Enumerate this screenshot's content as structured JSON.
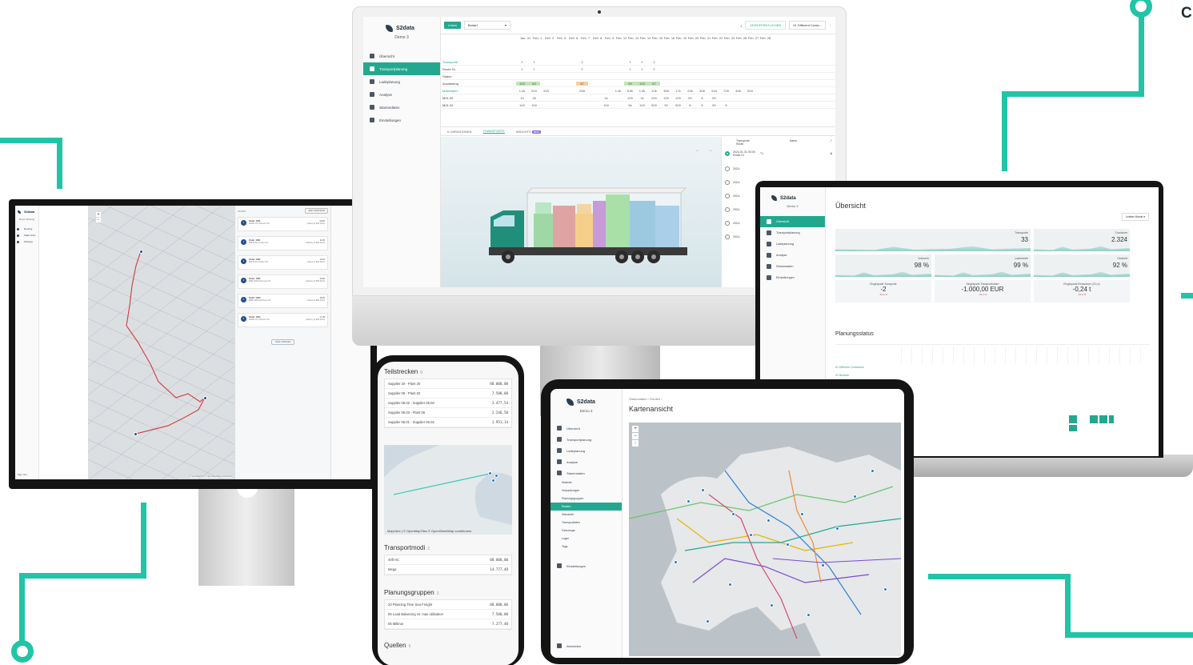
{
  "brand": {
    "logo": "S2data",
    "demo": "Demo 3",
    "accent": "#23a88f",
    "line_color": "#21c4a7"
  },
  "imac": {
    "toolbar": {
      "mode": "Lösen",
      "select": "Bedarf",
      "share": "VERÖFFENTLICHEN",
      "dropdown": "01 Different Conta..."
    },
    "sidebar": [
      "Übersicht",
      "Transportplanung",
      "Ladeplanung",
      "Analyse",
      "Stammdaten",
      "Einstellungen"
    ],
    "dates": [
      "Jan. 31",
      "Feb. 1",
      "Feb. 2",
      "Feb. 5",
      "Feb. 6",
      "Feb. 7",
      "Feb. 8",
      "Feb. 9",
      "Feb. 12",
      "Feb. 13",
      "Feb. 14",
      "Feb. 15",
      "Feb. 16",
      "Feb. 19",
      "Feb. 20",
      "Feb. 21",
      "Feb. 22",
      "Feb. 23",
      "Feb. 26",
      "Feb. 27",
      "Feb. 28"
    ],
    "rows": [
      {
        "label": "Transporte",
        "values": [
          "1",
          "1",
          "",
          "",
          "",
          "2",
          "",
          "",
          "",
          "1",
          "1",
          "2"
        ]
      },
      {
        "label": "Route 01",
        "values": [
          "1",
          "1",
          "",
          "",
          "",
          "2",
          "",
          "",
          "",
          "1",
          "1",
          "2"
        ]
      },
      {
        "label": "Status",
        "values": []
      },
      {
        "label": "Auslastung",
        "values": [
          "100",
          "83",
          "",
          "",
          "",
          "47",
          "",
          "",
          "",
          "99",
          "100",
          "87"
        ]
      },
      {
        "label": "Materialien",
        "values": [
          "1.2k",
          "915",
          "253",
          "",
          "",
          "258",
          "",
          "",
          "1.4k",
          "5.5k",
          "1.9k",
          "10k",
          "358",
          "17k",
          "236",
          "408",
          "918",
          "728",
          "496",
          "593"
        ]
      },
      {
        "label": "M01.00",
        "values": [
          "10",
          "18",
          "",
          "",
          "",
          "",
          "",
          "1k",
          "",
          "100",
          "1k",
          "200",
          "100",
          "100",
          "50",
          "8",
          "50"
        ]
      },
      {
        "label": "M01.02",
        "values": [
          "100",
          "100",
          "",
          "",
          "",
          "",
          "",
          "100",
          "",
          "5k",
          "100",
          "500",
          "30",
          "500",
          "8",
          "5",
          "50",
          "8"
        ]
      }
    ],
    "tabs": [
      "K-VARIATIONEN",
      "TRANSPORTE",
      "INSIGHTS"
    ],
    "insights_badge": "BETA",
    "route_panel": {
      "col1": "Transporte Route",
      "col2": "Name",
      "first": "2024-01-31 00:00 Route 01",
      "first_name": "T1",
      "rest": [
        "2024-",
        "2024-",
        "2024-",
        "2024-",
        "2024-",
        "2024-"
      ]
    }
  },
  "left_monitor": {
    "logo": "S2data",
    "demo": "Demo Routing",
    "sidebar": [
      "Routing",
      "Static links",
      "Settings"
    ],
    "panel_title": "STOPS",
    "add_button": "ADD YOUR STOP",
    "orders": [
      {
        "num": "1",
        "title": "Order: 1001",
        "addr": "20282 TN: Alhmstr UK",
        "time": "09:00",
        "note": "pickup of 900 Parts"
      },
      {
        "num": "2",
        "title": "Order: 1001",
        "addr": "900 ZUS London UK",
        "time": "11:00",
        "note": "delivery of 900 Parts"
      },
      {
        "num": "3",
        "title": "Order: 1002",
        "addr": "900 ZUS London UK",
        "time": "12:10",
        "note": "pickup of 500 Parts"
      },
      {
        "num": "4",
        "title": "Order: 1002",
        "addr": "BRE 2345 Ashmore UK",
        "time": "14:00",
        "note": "delivery of 500 Parts"
      },
      {
        "num": "5",
        "title": "Order: 1003",
        "addr": "BRE 2345 Ashmore UK",
        "time": "15:20",
        "note": "pickup of 900 Parts"
      },
      {
        "num": "6",
        "title": "Order: 1003",
        "addr": "20282 TN: Alhmstr UK",
        "time": "17:40",
        "note": "delivery of 900 Parts"
      }
    ],
    "save_button": "SAVE CHANGES",
    "sign_out": "Sign Out",
    "attribution": "© OpenMapTiles © OpenStreetMap contributors"
  },
  "laptop": {
    "logo": "S2data",
    "demo": "Demo 3",
    "sidebar": [
      "Übersicht",
      "Transportplanung",
      "Ladeplanung",
      "Analyse",
      "Stammdaten",
      "Einstellungen"
    ],
    "title": "Übersicht",
    "period": "Letzter Monat",
    "kpis": [
      {
        "label": "Transporte",
        "value": "33"
      },
      {
        "label": "Container",
        "value": "2.324"
      },
      {
        "label": "Volumen",
        "value": "98 %"
      },
      {
        "label": "Lademeter",
        "value": "99 %"
      },
      {
        "label": "Gewicht",
        "value": "92 %"
      }
    ],
    "deltas": [
      {
        "label": "Eingesparte Transporte",
        "value": "-2",
        "sub": "-15,2 %"
      },
      {
        "label": "Eingesparte Transportkosten",
        "value": "-1.000,00 EUR",
        "sub": "-15,2 %"
      },
      {
        "label": "Eingesparte Emissionen (CO₂e)",
        "value": "-0,24 t",
        "sub": "-15,2 %"
      }
    ],
    "status_title": "Planungsstatus",
    "status_rows": [
      "01 Different Containers",
      "02 Bedarfe"
    ]
  },
  "phone": {
    "sec1": {
      "title": "Teilstrecken",
      "count": "8",
      "rows": [
        {
          "name": "Supplier 20 - Plant 20",
          "val": "88.000,00"
        },
        {
          "name": "Supplier 05 - Plant 02",
          "val": "7.500,00"
        },
        {
          "name": "Supplier 06.02 - Supplier 06.03",
          "val": "3.477,54"
        },
        {
          "name": "Supplier 06.03 - Plant 06",
          "val": "2.246,50"
        },
        {
          "name": "Supplier 06.01 - Supplier 06.02",
          "val": "1.951,14"
        }
      ]
    },
    "map_attr": "MapLibre | © OpenMapTiles © OpenStreetMap contributors",
    "sec2": {
      "title": "Transportmodi",
      "count": "2",
      "rows": [
        {
          "name": "40ft HC",
          "val": "88.000,00"
        },
        {
          "name": "Mega",
          "val": "14.777,48"
        }
      ]
    },
    "sec3": {
      "title": "Planungsgruppen",
      "count": "3",
      "rows": [
        {
          "name": "20 Planning Time Sea Freight",
          "val": "88.000,00"
        },
        {
          "name": "05 Load Balancing vs. max utilization",
          "val": "7.500,00"
        },
        {
          "name": "06 Milkrun",
          "val": "7.277,48"
        }
      ]
    },
    "sec4": {
      "title": "Quellen",
      "count": "5"
    }
  },
  "tablet": {
    "logo": "S2data",
    "demo": "Demo 3",
    "breadcrumb": "Stammdaten  ›  Routen  ›",
    "title": "Kartenansicht",
    "sidebar": [
      "Übersicht",
      "Transportplanung",
      "Ladeplanung",
      "Analyse",
      "Stammdaten"
    ],
    "subitems": [
      "Material",
      "Verpackungen",
      "Planungsgruppen",
      "Routen",
      "Standorte",
      "Transportarten",
      "Fahrzeuge",
      "Lager",
      "Tags"
    ],
    "settings": "Einstellungen",
    "logout": "Abmelden"
  },
  "corner_text": "C"
}
